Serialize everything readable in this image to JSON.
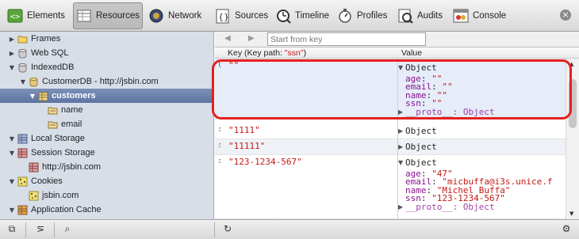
{
  "toolbar": {
    "tabs": [
      {
        "label": "Elements",
        "icon": "elements-icon"
      },
      {
        "label": "Resources",
        "icon": "resources-icon",
        "active": true
      },
      {
        "label": "Network",
        "icon": "network-icon"
      },
      {
        "label": "Sources",
        "icon": "sources-icon"
      },
      {
        "label": "Timeline",
        "icon": "timeline-icon"
      },
      {
        "label": "Profiles",
        "icon": "profiles-icon"
      },
      {
        "label": "Audits",
        "icon": "audits-icon"
      },
      {
        "label": "Console",
        "icon": "console-icon"
      }
    ],
    "close_glyph": "×"
  },
  "sidebar": {
    "items": [
      {
        "label": "Frames",
        "disclosure": "▶",
        "icon": "folder-icon"
      },
      {
        "label": "Web SQL",
        "disclosure": "▶",
        "icon": "database-icon"
      },
      {
        "label": "IndexedDB",
        "disclosure": "▼",
        "icon": "database-icon"
      },
      {
        "label": "CustomerDB - http://jsbin.com",
        "disclosure": "▼",
        "icon": "database-icon"
      },
      {
        "label": "customers",
        "disclosure": "▼",
        "icon": "object-store-icon",
        "selected": true
      },
      {
        "label": "name",
        "disclosure": "",
        "icon": "index-icon"
      },
      {
        "label": "email",
        "disclosure": "",
        "icon": "index-icon"
      },
      {
        "label": "Local Storage",
        "disclosure": "▼",
        "icon": "storage-grid-icon"
      },
      {
        "label": "Session Storage",
        "disclosure": "▼",
        "icon": "storage-grid-icon"
      },
      {
        "label": "http://jsbin.com",
        "disclosure": "",
        "icon": "storage-grid-icon"
      },
      {
        "label": "Cookies",
        "disclosure": "▼",
        "icon": "cookie-icon"
      },
      {
        "label": "jsbin.com",
        "disclosure": "",
        "icon": "cookie-icon"
      },
      {
        "label": "Application Cache",
        "disclosure": "▼",
        "icon": "app-cache-icon"
      }
    ]
  },
  "main": {
    "nav_back": "◀",
    "nav_forward": "▶",
    "start_key_placeholder": "Start from key",
    "col_key_prefix": "Key (Key path: ",
    "col_key_path": "\"ssn\"",
    "col_key_suffix": ")",
    "col_value": "Value",
    "rows": [
      {
        "lead": "(",
        "key": "\"\"",
        "expanded": true,
        "object_label": "Object",
        "props": [
          {
            "name": "age",
            "value": "\"\""
          },
          {
            "name": "email",
            "value": "\"\""
          },
          {
            "name": "name",
            "value": "\"\""
          },
          {
            "name": "ssn",
            "value": "\"\""
          }
        ],
        "proto": "__proto__: Object"
      },
      {
        "lead": ":",
        "key": "\"1111\"",
        "expanded": false,
        "object_label": "Object"
      },
      {
        "lead": ":",
        "key": "\"11111\"",
        "expanded": false,
        "object_label": "Object"
      },
      {
        "lead": ":",
        "key": "\"123-1234-567\"",
        "expanded": true,
        "object_label": "Object",
        "props": [
          {
            "name": "age",
            "value": "\"47\""
          },
          {
            "name": "email",
            "value": "\"micbuffa@i3s.unice.f"
          },
          {
            "name": "name",
            "value": "\"Michel Buffa\""
          },
          {
            "name": "ssn",
            "value": "\"123-1234-567\""
          }
        ],
        "proto": "__proto__: Object"
      }
    ]
  },
  "statusbar": {
    "dock_glyph": "⧉",
    "console_glyph": "⋝",
    "search_glyph": "⌕",
    "refresh_glyph": "↻",
    "settings_glyph": "⚙"
  },
  "colors": {
    "selection": "#6a81ad",
    "highlight_ring": "#e32020",
    "sidebar_bg": "#d7dee8"
  }
}
